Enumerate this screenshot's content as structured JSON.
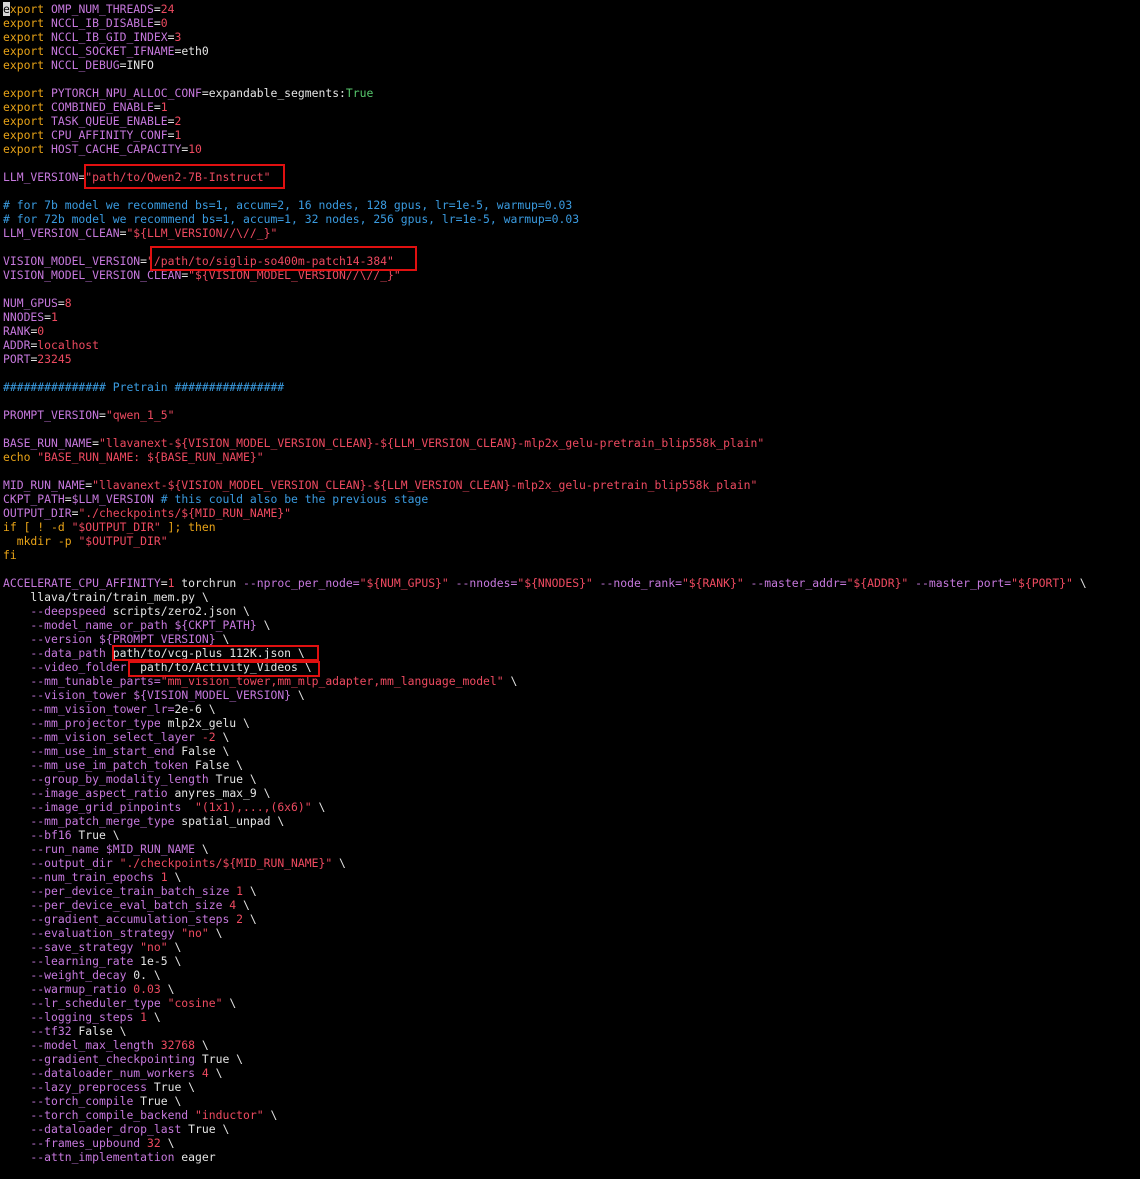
{
  "theme": {
    "background": "#000000",
    "colors": {
      "kw": "#e8a317",
      "var": "#c678dd",
      "str": "#ee4a60",
      "num": "#ee4a60",
      "com": "#3a9be0",
      "bool": "#57c96d",
      "plain": "#e4e4e4",
      "flag": "#c678dd",
      "highlight_box": "#e01010"
    }
  },
  "lines": [
    [
      [
        "kw",
        "export "
      ],
      [
        "var",
        "OMP_NUM_THREADS"
      ],
      [
        "plain",
        "="
      ],
      [
        "num",
        "24"
      ]
    ],
    [
      [
        "kw",
        "export "
      ],
      [
        "var",
        "NCCL_IB_DISABLE"
      ],
      [
        "plain",
        "="
      ],
      [
        "num",
        "0"
      ]
    ],
    [
      [
        "kw",
        "export "
      ],
      [
        "var",
        "NCCL_IB_GID_INDEX"
      ],
      [
        "plain",
        "="
      ],
      [
        "num",
        "3"
      ]
    ],
    [
      [
        "kw",
        "export "
      ],
      [
        "var",
        "NCCL_SOCKET_IFNAME"
      ],
      [
        "plain",
        "=eth0"
      ]
    ],
    [
      [
        "kw",
        "export "
      ],
      [
        "var",
        "NCCL_DEBUG"
      ],
      [
        "plain",
        "=INFO"
      ]
    ],
    [],
    [
      [
        "kw",
        "export "
      ],
      [
        "var",
        "PYTORCH_NPU_ALLOC_CONF"
      ],
      [
        "plain",
        "=expandable_segments:"
      ],
      [
        "bool",
        "True"
      ]
    ],
    [
      [
        "kw",
        "export "
      ],
      [
        "var",
        "COMBINED_ENABLE"
      ],
      [
        "plain",
        "="
      ],
      [
        "num",
        "1"
      ]
    ],
    [
      [
        "kw",
        "export "
      ],
      [
        "var",
        "TASK_QUEUE_ENABLE"
      ],
      [
        "plain",
        "="
      ],
      [
        "num",
        "2"
      ]
    ],
    [
      [
        "kw",
        "export "
      ],
      [
        "var",
        "CPU_AFFINITY_CONF"
      ],
      [
        "plain",
        "="
      ],
      [
        "num",
        "1"
      ]
    ],
    [
      [
        "kw",
        "export "
      ],
      [
        "var",
        "HOST_CACHE_CAPACITY"
      ],
      [
        "plain",
        "="
      ],
      [
        "num",
        "10"
      ]
    ],
    [],
    [
      [
        "var",
        "LLM_VERSION"
      ],
      [
        "plain",
        "="
      ],
      [
        "str",
        "\"path/to/Qwen2-7B-Instruct\""
      ]
    ],
    [],
    [
      [
        "com",
        "# for 7b model we recommend bs=1, accum=2, 16 nodes, 128 gpus, lr=1e-5, warmup=0.03"
      ]
    ],
    [
      [
        "com",
        "# for 72b model we recommend bs=1, accum=1, 32 nodes, 256 gpus, lr=1e-5, warmup=0.03"
      ]
    ],
    [
      [
        "var",
        "LLM_VERSION_CLEAN"
      ],
      [
        "plain",
        "="
      ],
      [
        "str",
        "\"${LLM_VERSION//\\//_}\""
      ]
    ],
    [],
    [
      [
        "var",
        "VISION_MODEL_VERSION"
      ],
      [
        "plain",
        "="
      ],
      [
        "str",
        "\"/path/to/siglip-so400m-patch14-384\""
      ]
    ],
    [
      [
        "var",
        "VISION_MODEL_VERSION_CLEAN"
      ],
      [
        "plain",
        "="
      ],
      [
        "str",
        "\"${VISION_MODEL_VERSION//\\//_}\""
      ]
    ],
    [],
    [
      [
        "var",
        "NUM_GPUS"
      ],
      [
        "plain",
        "="
      ],
      [
        "num",
        "8"
      ]
    ],
    [
      [
        "var",
        "NNODES"
      ],
      [
        "plain",
        "="
      ],
      [
        "num",
        "1"
      ]
    ],
    [
      [
        "var",
        "RANK"
      ],
      [
        "plain",
        "="
      ],
      [
        "num",
        "0"
      ]
    ],
    [
      [
        "var",
        "ADDR"
      ],
      [
        "plain",
        "="
      ],
      [
        "str",
        "localhost"
      ]
    ],
    [
      [
        "var",
        "PORT"
      ],
      [
        "plain",
        "="
      ],
      [
        "num",
        "23245"
      ]
    ],
    [],
    [
      [
        "com",
        "############### Pretrain ################"
      ]
    ],
    [],
    [
      [
        "var",
        "PROMPT_VERSION"
      ],
      [
        "plain",
        "="
      ],
      [
        "str",
        "\"qwen_1_5\""
      ]
    ],
    [],
    [
      [
        "var",
        "BASE_RUN_NAME"
      ],
      [
        "plain",
        "="
      ],
      [
        "str",
        "\"llavanext-${VISION_MODEL_VERSION_CLEAN}-${LLM_VERSION_CLEAN}-mlp2x_gelu-pretrain_blip558k_plain\""
      ]
    ],
    [
      [
        "kw",
        "echo "
      ],
      [
        "str",
        "\"BASE_RUN_NAME: ${BASE_RUN_NAME}\""
      ]
    ],
    [],
    [
      [
        "var",
        "MID_RUN_NAME"
      ],
      [
        "plain",
        "="
      ],
      [
        "str",
        "\"llavanext-${VISION_MODEL_VERSION_CLEAN}-${LLM_VERSION_CLEAN}-mlp2x_gelu-pretrain_blip558k_plain\""
      ]
    ],
    [
      [
        "var",
        "CKPT_PATH"
      ],
      [
        "plain",
        "="
      ],
      [
        "var",
        "$LLM_VERSION"
      ],
      [
        "com",
        " # this could also be the previous stage"
      ]
    ],
    [
      [
        "var",
        "OUTPUT_DIR"
      ],
      [
        "plain",
        "="
      ],
      [
        "str",
        "\"./checkpoints/${MID_RUN_NAME}\""
      ]
    ],
    [
      [
        "kw",
        "if [ ! -d "
      ],
      [
        "str",
        "\"$OUTPUT_DIR\""
      ],
      [
        "kw",
        " ]; then"
      ]
    ],
    [
      [
        "kw",
        "  mkdir -p "
      ],
      [
        "str",
        "\"$OUTPUT_DIR\""
      ]
    ],
    [
      [
        "kw",
        "fi"
      ]
    ],
    [],
    [
      [
        "var",
        "ACCELERATE_CPU_AFFINITY"
      ],
      [
        "plain",
        "="
      ],
      [
        "num",
        "1"
      ],
      [
        "plain",
        " torchrun "
      ],
      [
        "flag",
        "--nproc_per_node="
      ],
      [
        "str",
        "\"${NUM_GPUS}\""
      ],
      [
        "flag",
        " --nnodes="
      ],
      [
        "str",
        "\"${NNODES}\""
      ],
      [
        "flag",
        " --node_rank="
      ],
      [
        "str",
        "\"${RANK}\""
      ],
      [
        "flag",
        " --master_addr="
      ],
      [
        "str",
        "\"${ADDR}\""
      ],
      [
        "flag",
        " --master_port="
      ],
      [
        "str",
        "\"${PORT}\""
      ],
      [
        "plain",
        " \\"
      ]
    ],
    [
      [
        "plain",
        "    llava/train/train_mem.py \\"
      ]
    ],
    [
      [
        "flag",
        "    --deepspeed"
      ],
      [
        "plain",
        " scripts/zero2.json \\"
      ]
    ],
    [
      [
        "flag",
        "    --model_name_or_path"
      ],
      [
        "var",
        " ${CKPT_PATH}"
      ],
      [
        "plain",
        " \\"
      ]
    ],
    [
      [
        "flag",
        "    --version"
      ],
      [
        "var",
        " ${PROMPT_VERSION}"
      ],
      [
        "plain",
        " \\"
      ]
    ],
    [
      [
        "flag",
        "    --data_path"
      ],
      [
        "plain",
        " path/to/vcg-plus_112K.json \\"
      ]
    ],
    [
      [
        "flag",
        "    --video_folder"
      ],
      [
        "plain",
        "  path/to/Activity_Videos \\"
      ]
    ],
    [
      [
        "flag",
        "    --mm_tunable_parts="
      ],
      [
        "str",
        "\"mm_vision_tower,mm_mlp_adapter,mm_language_model\""
      ],
      [
        "plain",
        " \\"
      ]
    ],
    [
      [
        "flag",
        "    --vision_tower"
      ],
      [
        "var",
        " ${VISION_MODEL_VERSION}"
      ],
      [
        "plain",
        " \\"
      ]
    ],
    [
      [
        "flag",
        "    --mm_vision_tower_lr="
      ],
      [
        "plain",
        "2e-6 \\"
      ]
    ],
    [
      [
        "flag",
        "    --mm_projector_type"
      ],
      [
        "plain",
        " mlp2x_gelu \\"
      ]
    ],
    [
      [
        "flag",
        "    --mm_vision_select_layer"
      ],
      [
        "num",
        " -2"
      ],
      [
        "plain",
        " \\"
      ]
    ],
    [
      [
        "flag",
        "    --mm_use_im_start_end"
      ],
      [
        "plain",
        " False \\"
      ]
    ],
    [
      [
        "flag",
        "    --mm_use_im_patch_token"
      ],
      [
        "plain",
        " False \\"
      ]
    ],
    [
      [
        "flag",
        "    --group_by_modality_length"
      ],
      [
        "plain",
        " True \\"
      ]
    ],
    [
      [
        "flag",
        "    --image_aspect_ratio"
      ],
      [
        "plain",
        " anyres_max_9 \\"
      ]
    ],
    [
      [
        "flag",
        "    --image_grid_pinpoints"
      ],
      [
        "str",
        "  \"(1x1),...,(6x6)\""
      ],
      [
        "plain",
        " \\"
      ]
    ],
    [
      [
        "flag",
        "    --mm_patch_merge_type"
      ],
      [
        "plain",
        " spatial_unpad \\"
      ]
    ],
    [
      [
        "flag",
        "    --bf16"
      ],
      [
        "plain",
        " True \\"
      ]
    ],
    [
      [
        "flag",
        "    --run_name"
      ],
      [
        "var",
        " $MID_RUN_NAME"
      ],
      [
        "plain",
        " \\"
      ]
    ],
    [
      [
        "flag",
        "    --output_dir"
      ],
      [
        "str",
        " \"./checkpoints/${MID_RUN_NAME}\""
      ],
      [
        "plain",
        " \\"
      ]
    ],
    [
      [
        "flag",
        "    --num_train_epochs"
      ],
      [
        "num",
        " 1"
      ],
      [
        "plain",
        " \\"
      ]
    ],
    [
      [
        "flag",
        "    --per_device_train_batch_size"
      ],
      [
        "num",
        " 1"
      ],
      [
        "plain",
        " \\"
      ]
    ],
    [
      [
        "flag",
        "    --per_device_eval_batch_size"
      ],
      [
        "num",
        " 4"
      ],
      [
        "plain",
        " \\"
      ]
    ],
    [
      [
        "flag",
        "    --gradient_accumulation_steps"
      ],
      [
        "num",
        " 2"
      ],
      [
        "plain",
        " \\"
      ]
    ],
    [
      [
        "flag",
        "    --evaluation_strategy"
      ],
      [
        "str",
        " \"no\""
      ],
      [
        "plain",
        " \\"
      ]
    ],
    [
      [
        "flag",
        "    --save_strategy"
      ],
      [
        "str",
        " \"no\""
      ],
      [
        "plain",
        " \\"
      ]
    ],
    [
      [
        "flag",
        "    --learning_rate"
      ],
      [
        "plain",
        " 1e-5 \\"
      ]
    ],
    [
      [
        "flag",
        "    --weight_decay"
      ],
      [
        "plain",
        " 0. \\"
      ]
    ],
    [
      [
        "flag",
        "    --warmup_ratio"
      ],
      [
        "num",
        " 0.03"
      ],
      [
        "plain",
        " \\"
      ]
    ],
    [
      [
        "flag",
        "    --lr_scheduler_type"
      ],
      [
        "str",
        " \"cosine\""
      ],
      [
        "plain",
        " \\"
      ]
    ],
    [
      [
        "flag",
        "    --logging_steps"
      ],
      [
        "num",
        " 1"
      ],
      [
        "plain",
        " \\"
      ]
    ],
    [
      [
        "flag",
        "    --tf32"
      ],
      [
        "plain",
        " False \\"
      ]
    ],
    [
      [
        "flag",
        "    --model_max_length"
      ],
      [
        "num",
        " 32768"
      ],
      [
        "plain",
        " \\"
      ]
    ],
    [
      [
        "flag",
        "    --gradient_checkpointing"
      ],
      [
        "plain",
        " True \\"
      ]
    ],
    [
      [
        "flag",
        "    --dataloader_num_workers"
      ],
      [
        "num",
        " 4"
      ],
      [
        "plain",
        " \\"
      ]
    ],
    [
      [
        "flag",
        "    --lazy_preprocess"
      ],
      [
        "plain",
        " True \\"
      ]
    ],
    [
      [
        "flag",
        "    --torch_compile"
      ],
      [
        "plain",
        " True \\"
      ]
    ],
    [
      [
        "flag",
        "    --torch_compile_backend"
      ],
      [
        "str",
        " \"inductor\""
      ],
      [
        "plain",
        " \\"
      ]
    ],
    [
      [
        "flag",
        "    --dataloader_drop_last"
      ],
      [
        "plain",
        " True \\"
      ]
    ],
    [
      [
        "flag",
        "    --frames_upbound"
      ],
      [
        "num",
        " 32"
      ],
      [
        "plain",
        " \\"
      ]
    ],
    [
      [
        "flag",
        "    --attn_implementation"
      ],
      [
        "plain",
        " eager"
      ]
    ]
  ]
}
